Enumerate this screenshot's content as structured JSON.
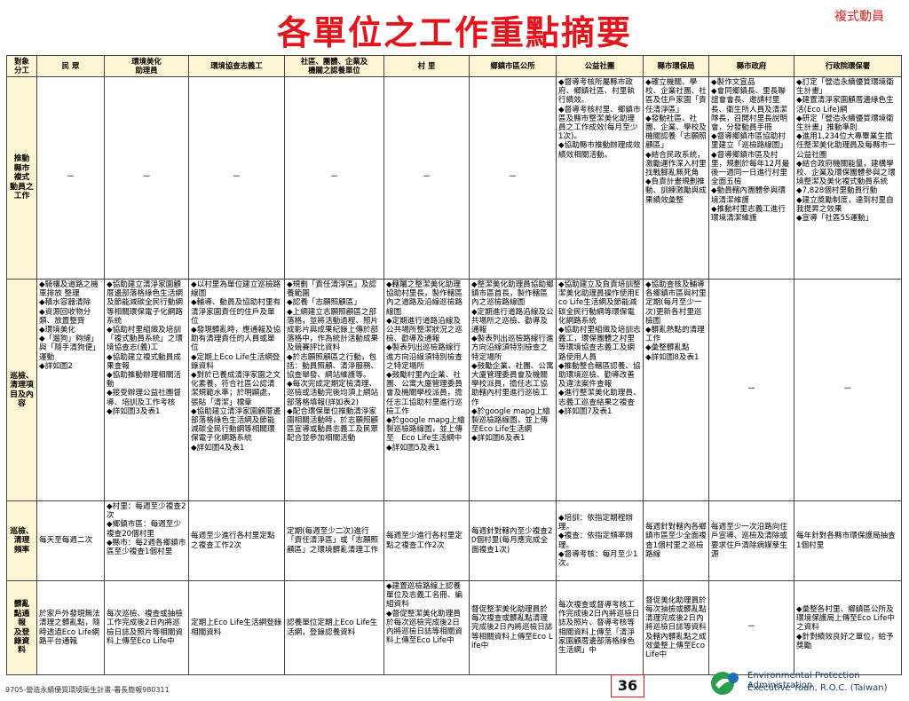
{
  "corner_label": "複式動員",
  "title": "各單位之工作重點摘要",
  "headers": [
    "對象\n分工",
    "民 眾",
    "環境美化\n助理員",
    "環境協查志義工",
    "社區、團體、企業及\n機關之認養單位",
    "村 里",
    "鄉鎮市區公所",
    "公益社團",
    "縣市環保局",
    "縣市政府",
    "行政院環保署"
  ],
  "rows": [
    {
      "label": "推動\n縣市\n複式\n動員之\n工作",
      "cells": [
        "－",
        "－",
        "－",
        "－",
        "－",
        "－",
        "◆督導考核所屬縣市政府、鄉鎮社區、村里執行績效。\n◆督導考核村里、鄉鎮市區及縣市整潔美化助理員之工作成效(每月至少1次)。\n◆協助縣市推動辦理成效績效相關活動。",
        "◆確立機關、學校、企業社團、社區及住戶家園「責任清淨區」\n◆發動社區、社團、企業、學校及機關認養「志願照顧區」\n◆結合民政系統，激勵運作深入村里找戰腳亂無死角\n◆負責計畫規劃推動、訓練激勵與成果績效彙整",
        "◆製作文宣品\n◆會同鄉鎮長、里長聯誼會會長、邀請村里長、衛生所人員及清潔隊長，召開村里長說明會，分發動員手冊\n◆督導鄉鎮市區協助村里建立「巡檢路線圖」\n◆督導鄉鎮市區及村里，規劃於每年12月最後一週同一日進行村里全面五檢\n◆動員轄內團體參與環境清潔維護\n◆推動村里志義工進行環境清潔維護",
        "◆訂定「營造永續優質環境衛生計畫」\n◆建置清淨家園顧厝邊綠色生活(Eco Life)網\n◆研定「營造永續優質環境衛生計畫」推動準則\n◆進用1,234位大專畢業生擔任整潔美化助理員及每縣市一公益社團\n◆結合政府機關能量，建構學校、企業及環保團體參與之環境整潔及美化複式動員系統\n◆7,828個村里動員行動\n◆建立獎勵制度，達到村里自我提昇之效果\n◆宣導「社區5S運動」"
      ]
    },
    {
      "label": "巡檢、\n清理項\n目及內\n容",
      "cells": [
        "◆騎樓及道路之機車排放 整理\n◆積水容器清除\n◆資源回收物分類、放置整齊\n◆環境美化\n◆「遛狗」夠縺」與「隨手清狗便」運動\n◆詳如圖2",
        "◆協助建立清淨家園顧厝邊部落格綠色生活網及節能減碳全民行動網等相關環保電子化網路系統\n◆協助村里組織及培訓「複式動員系統」之環境協查志(義)工\n◆協助建立複式動員成果查報\n◆協助推動辦理相關活動\n◆接受辦理公益社團督導、培訓及工作考核\n◆詳如圖3及表1",
        "◆以村里為單位建立巡檢路線圖\n◆輔導、動員及協助村里有清淨家園責任的住戶及單位\n◆發現髒亂時，應通報及協助有清理責任的人員或單位\n◆定期上Eco Life生活網登錄資料\n◆對於已養成清淨家園之文化素養，符合社區公認清潔規範水準；於明顯處，張貼「清潔」標章\n◆協助建立清淨家園顧厝邊部落格綠色生活網及節能減碳全民行動網等相關環保電子化網路系統\n◆詳如圖4及表1",
        "◆規劃「責任清淨區」及認養範圍\n◆認養「志願照顧區」\n◆上網建立志願照顧區之部落格，並將活動過程、照片成影片與成果紀錄上傳於部落格中，作為統計活動成果及競賽評比資料\n◆於志願照顧區之行動，包括：動員照顧、清淨服務、協查舉發、網站維護等。\n◆每次完成定期定檢清理、巡檢或活動完後均須上網站部落格填報(詳如表2)\n◆配合環保單位推動清淨家園相關活動時，於志願照顧區宣導或動員志義工及民眾配合並參加相關活動",
        "◆轄屬之整潔美化助理協助村里長，製作轄區內之道路及沿線巡檢路線圖\n◆定期進行道路沿線及公共場所整潔狀況之巡檢、勸導及通報\n◆製表列出巡檢路線行進方向沿線須特別檢查之特定場所\n◆鼓勵村里內企業、社團、公寓大廈管理委員會及機關學校派員，擔任志工協助村里進行巡檢工作\n◆於google mapg上繪製巡檢路線圖，並上傳至　Eco Life生活網中\n◆詳如圖5及表1",
        "◆整潔美化助理員協助鄉鎮市區首長，製作轄區內之巡檢路線圖\n◆定期進行道路沿線及公共場所之巡檢、勸導及通報\n◆製表列出巡檢路線行進方向沿線須特別檢查之特定場所\n◆鼓勵企業、社團、公寓大廈管理委員會及機關學校派員，擔任志工協助轄內村里進行巡檢工作\n◆於google mapg上繪製巡檢路線圖，並上傳至Eco Life生活網\n◆詳如圖6及表1",
        "◆協助建立及負責培訓整潔美化助理員操作使用Eco Life生活網及節能減碳全民行動網等環保電化網路系統\n◆協助村里組織及培訓志義工，環保團體之村里等環境協查志義工及網路使用人員\n◆推動整合轄區認養、協助環境巡檢、勸導改善及違法案件查報\n◆進行整潔美化助理員、志義工巡查結果之複查\n◆詳如圖7及表1",
        "◆協助查核及輔導各鄉鎮市區與村里定期(每月至少一次)更新各村里巡檢圖\n◆髒亂熱點的清理工作\n◆彙整髒亂點\n◆詳如圖8及表1",
        "－",
        "－"
      ]
    },
    {
      "label": "巡檢、\n清理\n頻率",
      "cells": [
        "每天至每週二次",
        "◆村里：每週至少複查2次\n◆鄉鎮市區：每週至少複查20個村里\n◆縣市：每2週各鄉鎮市區至少複查1個村里",
        "每週至少進行各村里定點之複查工作2次",
        "定期(每週至少二次)進行「責任清淨區」或「志願照顧區」之環境髒亂清理工作",
        "每週至少進行各村里定點之複查工作2次",
        "每週針對轄內至少複查20個村里(每月應完成全面複查1次)",
        "◆培訓：依指定期程辦理。\n◆複查：依指定頻率辦理。\n◆督導考核：每月至少1次。",
        "每週針對轄內各鄉鎮市區至少全面複查1個村里之巡檢路線",
        "每週至少一次沿路向住戶宣導、巡檢及清除或要求住戶清除病媒孳生源",
        "每年針對各縣市環保護局抽查1個村里"
      ]
    },
    {
      "label": "髒亂\n點通\n報\n及登\n錄資\n料",
      "cells": [
        "於家戶外發現無法清理之髒亂點，隨時透過Eco Life網路平台通報",
        "每次巡檢、複查或抽檢工作完成後2日內將巡檢日誌及照片等相關資料上傳至Eco Life中",
        "定期上Eco Life生活網登錄相關資料",
        "認養單位定期上Eco Life生活網，登錄認養資料",
        "◆建置巡檢路線上認養單位及志義工名冊、編組資料\n◆督促整潔美化助理員於每次巡檢完成後2日內將巡檢日誌等相關資料上傳至Eco Life中",
        "督促整潔美化助理員於每次複查或髒亂點清理完成後2日內將巡檢日誌等相關資料上傳至Eco Life中",
        "每次複查或督導考核工作完成後2日內將巡檢日誌及照片、督導考核等相關資料上傳至「清淨家園顧厝邊部落格綠色生活網」中",
        "督促美化助理員於每次抽檢或髒亂點清理完成後2日內將巡檢日誌等資料及轄內髒亂點之成效彙整上傳至Eco Life中",
        "－",
        "◆彙整各村里、鄉鎮區公所及環境保護局上傳至Eco Life中之資料\n◆針對績效良好之單位，給予獎勵"
      ]
    }
  ],
  "footer_note": "9705-營造永續優質環境衛生計畫-署長簡報980311",
  "page_number": "36",
  "agency_en_line1": "Environmental Protection Administration",
  "agency_en_line2": "Executive Yuan, R.O.C. (Taiwan)"
}
